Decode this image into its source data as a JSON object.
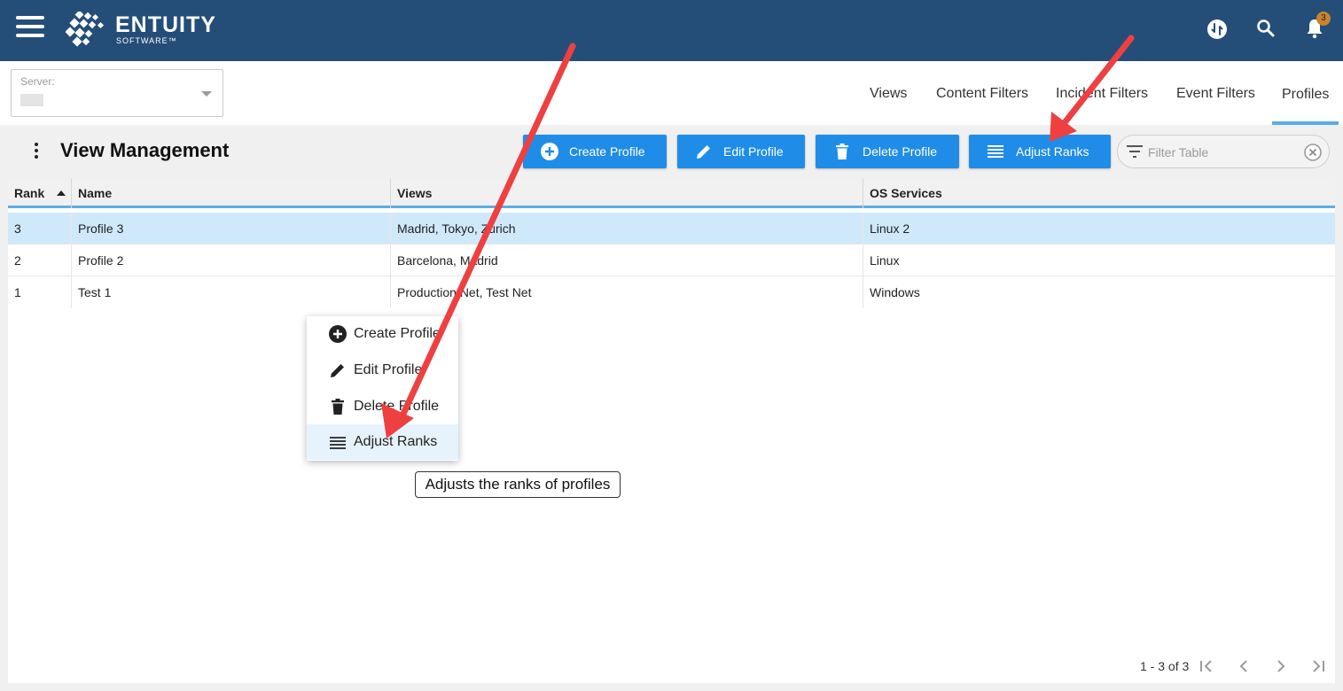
{
  "brand": {
    "name": "ENTUITY",
    "sub": "SOFTWARE™"
  },
  "topbar": {
    "notification_count": "3"
  },
  "server": {
    "label": "Server:"
  },
  "tabs": [
    {
      "label": "Views"
    },
    {
      "label": "Content Filters"
    },
    {
      "label": "Incident Filters"
    },
    {
      "label": "Event Filters"
    },
    {
      "label": "Profiles"
    }
  ],
  "page": {
    "title": "View Management"
  },
  "toolbar": {
    "create_label": "Create Profile",
    "edit_label": "Edit Profile",
    "delete_label": "Delete Profile",
    "adjust_label": "Adjust Ranks",
    "filter_placeholder": "Filter Table"
  },
  "table": {
    "columns": [
      "Rank",
      "Name",
      "Views",
      "OS Services"
    ],
    "rows": [
      {
        "rank": "3",
        "name": "Profile 3",
        "views": "Madrid, Tokyo, Zurich",
        "os": "Linux 2"
      },
      {
        "rank": "2",
        "name": "Profile 2",
        "views": "Barcelona, Madrid",
        "os": "Linux"
      },
      {
        "rank": "1",
        "name": "Test 1",
        "views": "Production Net, Test Net",
        "os": "Windows"
      }
    ]
  },
  "context_menu": {
    "items": [
      {
        "label": "Create Profile",
        "icon": "add-circle-icon"
      },
      {
        "label": "Edit Profile",
        "icon": "pencil-icon"
      },
      {
        "label": "Delete Profile",
        "icon": "trash-icon"
      },
      {
        "label": "Adjust Ranks",
        "icon": "lines-icon"
      }
    ]
  },
  "tooltip": {
    "text": "Adjusts the ranks of profiles"
  },
  "pagination": {
    "text": "1 - 3 of 3"
  },
  "colors": {
    "topbar": "#244e78",
    "button": "#1f8de8",
    "accent": "#5aaee6",
    "selected_row": "#cfe9fb",
    "annotation_arrow": "#ee4040"
  }
}
